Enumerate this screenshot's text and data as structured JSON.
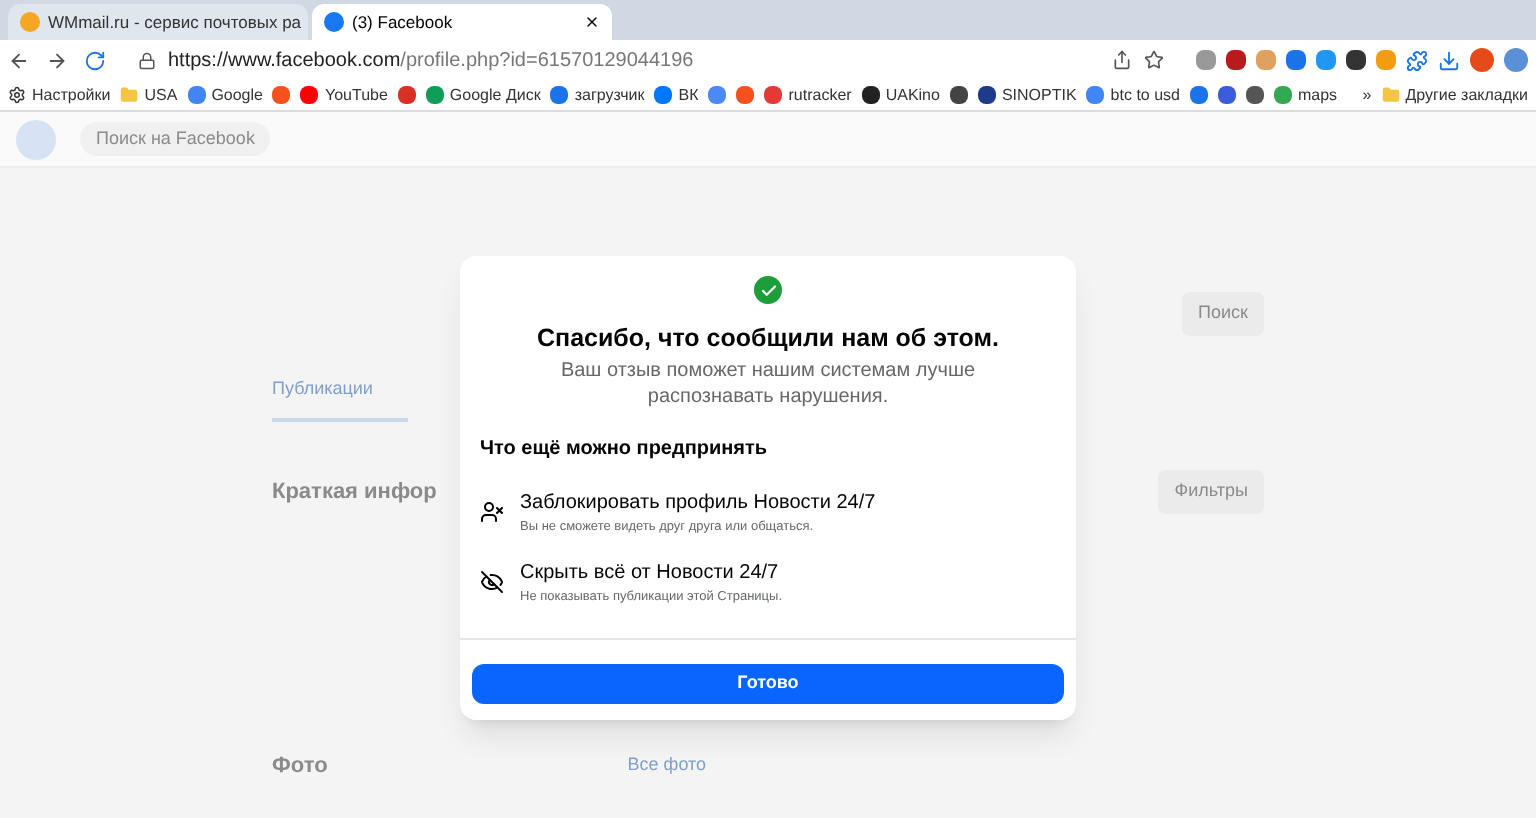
{
  "browser": {
    "tabs": [
      {
        "title": "WMmail.ru - сервис почтовых ра",
        "selected": false
      },
      {
        "title": "(3) Facebook",
        "selected": true
      }
    ],
    "url": {
      "host": "https://www.facebook.com",
      "path": "/profile.php?id=61570129044196"
    },
    "bookmarks": [
      {
        "kind": "gear",
        "label": "Настройки"
      },
      {
        "kind": "folder",
        "label": "USA"
      },
      {
        "kind": "site",
        "label": "Google",
        "color": "#4285f4"
      },
      {
        "kind": "site",
        "color": "#f4511e"
      },
      {
        "kind": "site",
        "label": "YouTube",
        "color": "#ff0000"
      },
      {
        "kind": "site",
        "color": "#d93025"
      },
      {
        "kind": "site",
        "label": "Google Диск",
        "color": "#0f9d58"
      },
      {
        "kind": "site",
        "label": "загрузчик",
        "color": "#1a73e8"
      },
      {
        "kind": "site",
        "label": "ВК",
        "color": "#0077ff"
      },
      {
        "kind": "site",
        "color": "#4a8af4"
      },
      {
        "kind": "site",
        "color": "#f4511e"
      },
      {
        "kind": "site",
        "label": "rutracker",
        "color": "#e53935"
      },
      {
        "kind": "site",
        "label": "UAKino",
        "color": "#222222"
      },
      {
        "kind": "site",
        "color": "#444444"
      },
      {
        "kind": "site",
        "label": "SINOPTIK",
        "color": "#1e3a8a"
      },
      {
        "kind": "site",
        "label": "btc to usd",
        "color": "#4285f4"
      },
      {
        "kind": "site",
        "color": "#1a73e8"
      },
      {
        "kind": "site",
        "color": "#3b5bdb"
      },
      {
        "kind": "site",
        "color": "#555555"
      },
      {
        "kind": "site",
        "label": "maps",
        "color": "#34a853"
      }
    ],
    "overflow": "»",
    "other_bookmarks": "Другие закладки"
  },
  "page": {
    "search_placeholder": "Поиск на Facebook",
    "tab": "Публикации",
    "intro_title": "Краткая инфор",
    "photos_title": "Фото",
    "all_photos": "Все фото",
    "filters": "Фильтры",
    "search_button": "Поиск"
  },
  "dialog": {
    "title": "Спасибо, что сообщили нам об этом.",
    "subtitle": "Ваш отзыв поможет нашим системам лучше распознавать нарушения.",
    "section": "Что ещё можно предпринять",
    "actions": [
      {
        "kind": "block",
        "title": "Заблокировать профиль Новости 24/7",
        "description": "Вы не сможете видеть друг друга или общаться."
      },
      {
        "kind": "hide",
        "title": "Скрыть всё от Новости 24/7",
        "description": "Не показывать публикации этой Страницы."
      }
    ],
    "done_button": "Готово"
  }
}
